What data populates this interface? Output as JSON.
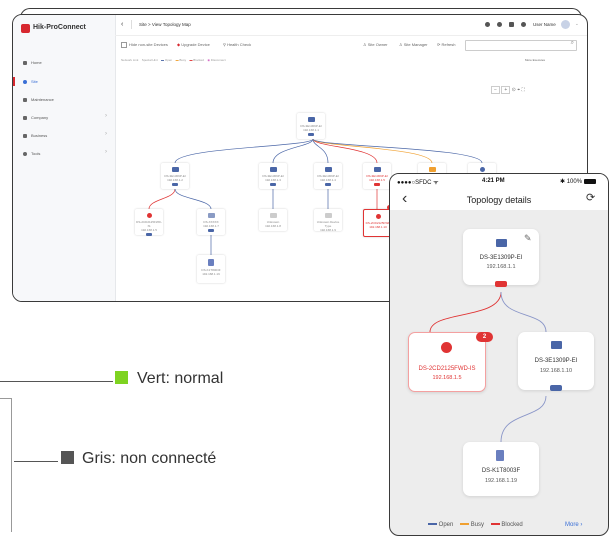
{
  "desktop": {
    "app_name": "Hik-ProConnect",
    "breadcrumb": "Site > View Topology Map",
    "user_name": "User Name",
    "sidebar_items": [
      {
        "label": "Home",
        "icon": "home-icon"
      },
      {
        "label": "Site",
        "icon": "site-icon",
        "active": true
      },
      {
        "label": "Maintenance",
        "icon": "maintenance-icon"
      },
      {
        "label": "Company",
        "icon": "company-icon"
      },
      {
        "label": "Business",
        "icon": "business-icon"
      },
      {
        "label": "Tools",
        "icon": "tools-icon"
      }
    ],
    "toolbar": {
      "hide_non_site_devices": "Hide non-site Devices",
      "upgrade_device": "Upgrade Device",
      "health_check": "Health Check",
      "site_owner": "Site Owner",
      "site_manager": "Site Manager",
      "refresh": "Refresh"
    },
    "legend": {
      "items": [
        "Network Link",
        "Special Hint",
        "Open",
        "Busy",
        "Blocked",
        "Disconnect"
      ],
      "more": "More Executes"
    },
    "nodes": [
      {
        "name": "DS-3E1309P-EI",
        "ip": "192.168.1.1"
      },
      {
        "name": "DS-3E1309P-EI",
        "ip": "192.168.1.2"
      },
      {
        "name": "DS-3E1309P-EI",
        "ip": "192.168.1.3"
      },
      {
        "name": "DS-3E1309P-EI",
        "ip": "192.168.1.4"
      },
      {
        "name": "DS-3E1309P-EI",
        "ip": "192.168.1.5"
      },
      {
        "name": "Virtual Network Switch",
        "ip": ""
      },
      {
        "name": "DS-2CD2185FWD",
        "ip": "192.168.1.6"
      },
      {
        "name": "DS-2CD2125FWD-IS",
        "ip": "192.168.1.5"
      },
      {
        "name": "DS-XXXXX",
        "ip": "192.168.1.7"
      },
      {
        "name": "Unknown",
        "ip": "192.168.1.8"
      },
      {
        "name": "Unknown Device Type",
        "ip": "192.168.1.9"
      },
      {
        "name": "DS-2CD2125FWD",
        "ip": "192.168.1.10"
      },
      {
        "name": "DS-K1T8003F",
        "ip": "192.168.1.19"
      }
    ]
  },
  "phone": {
    "carrier": "SFDC",
    "time": "4:21 PM",
    "battery": "100%",
    "title": "Topology details",
    "badge": "2",
    "nodes": [
      {
        "name": "DS-3E1309P-EI",
        "ip": "192.168.1.1"
      },
      {
        "name": "DS-2CD2125FWD-IS",
        "ip": "192.168.1.5"
      },
      {
        "name": "DS-3E1309P-EI",
        "ip": "192.168.1.10"
      },
      {
        "name": "DS-K1T8003F",
        "ip": "192.168.1.19"
      }
    ],
    "legend": {
      "open": "Open",
      "busy": "Busy",
      "blocked": "Blocked",
      "more": "More"
    }
  },
  "callouts": {
    "green": "Vert: normal",
    "grey": "Gris: non connecté"
  },
  "colors": {
    "open": "#4a66a7",
    "busy": "#f0a030",
    "blocked": "#e03434",
    "normal": "#7ed321",
    "not_connected": "#555555"
  }
}
